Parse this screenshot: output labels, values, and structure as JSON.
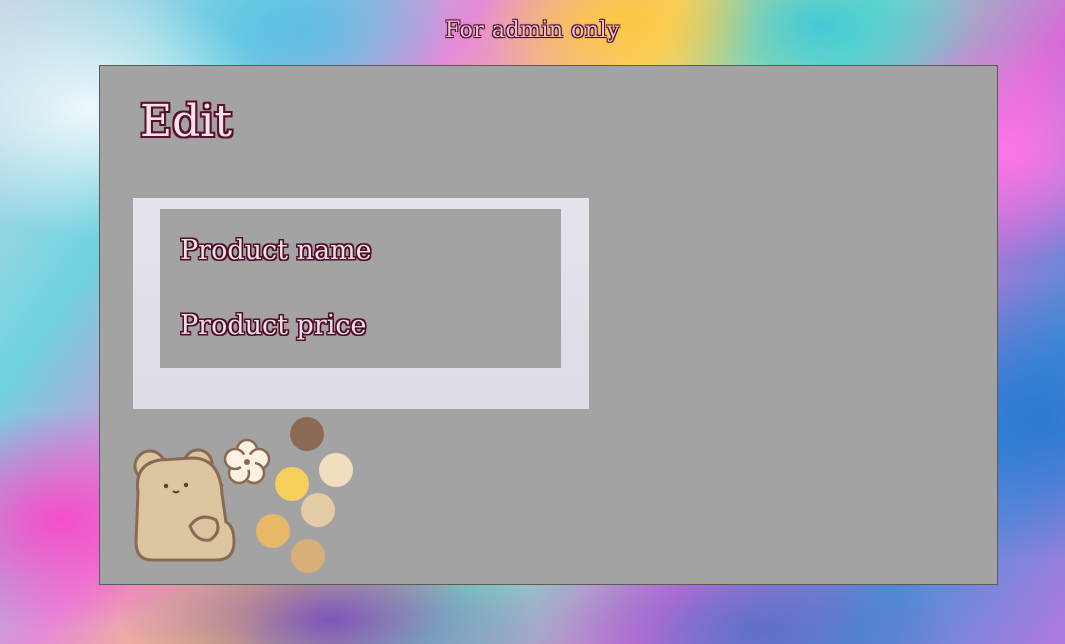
{
  "header": {
    "label": "For admin only"
  },
  "panel": {
    "title": "Edit",
    "fields": [
      {
        "label": "Product name"
      },
      {
        "label": "Product price"
      }
    ]
  },
  "decoration": {
    "icon": "bear-with-flower-sticker"
  },
  "colors": {
    "panel_bg": "#a3a3a3",
    "frame_bg": "#e0e0e8",
    "text_outline": "#5a0f2e",
    "text_fill": "#f6e3ee"
  }
}
